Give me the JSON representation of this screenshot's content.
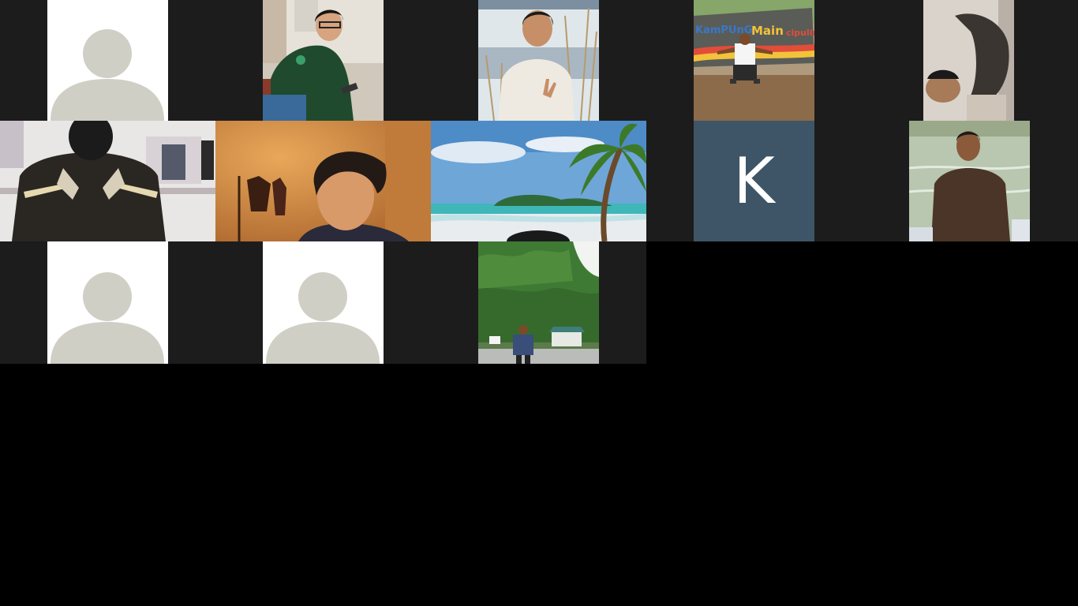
{
  "meeting": {
    "app": "video-conference-gallery",
    "participants": [
      {
        "id": "p1",
        "type": "avatar-placeholder"
      },
      {
        "id": "p2",
        "type": "video",
        "scene": "man-green-jacket-phone"
      },
      {
        "id": "p3",
        "type": "video",
        "scene": "man-peace-sign-lake"
      },
      {
        "id": "p4",
        "type": "video",
        "scene": "man-sitting-sign-kampung-main-cipulir",
        "sign_text": "KamPUnG Main cipulir"
      },
      {
        "id": "p5",
        "type": "video",
        "scene": "rotated-selfie"
      },
      {
        "id": "p6",
        "type": "video",
        "scene": "rider-heart-hands"
      },
      {
        "id": "p7",
        "type": "video",
        "scene": "young-man-orange-room"
      },
      {
        "id": "p8",
        "type": "video",
        "scene": "beach-palm-tree"
      },
      {
        "id": "p9",
        "type": "initial",
        "initial": "K"
      },
      {
        "id": "p10",
        "type": "video",
        "scene": "man-by-lake"
      },
      {
        "id": "p11",
        "type": "avatar-placeholder"
      },
      {
        "id": "p12",
        "type": "avatar-placeholder"
      },
      {
        "id": "p13",
        "type": "video",
        "scene": "man-forest-road"
      }
    ]
  },
  "colors": {
    "background": "#000000",
    "tile_background": "#1c1c1c",
    "avatar_silhouette": "#d0cfc5",
    "initial_tile": "#3d5566"
  }
}
